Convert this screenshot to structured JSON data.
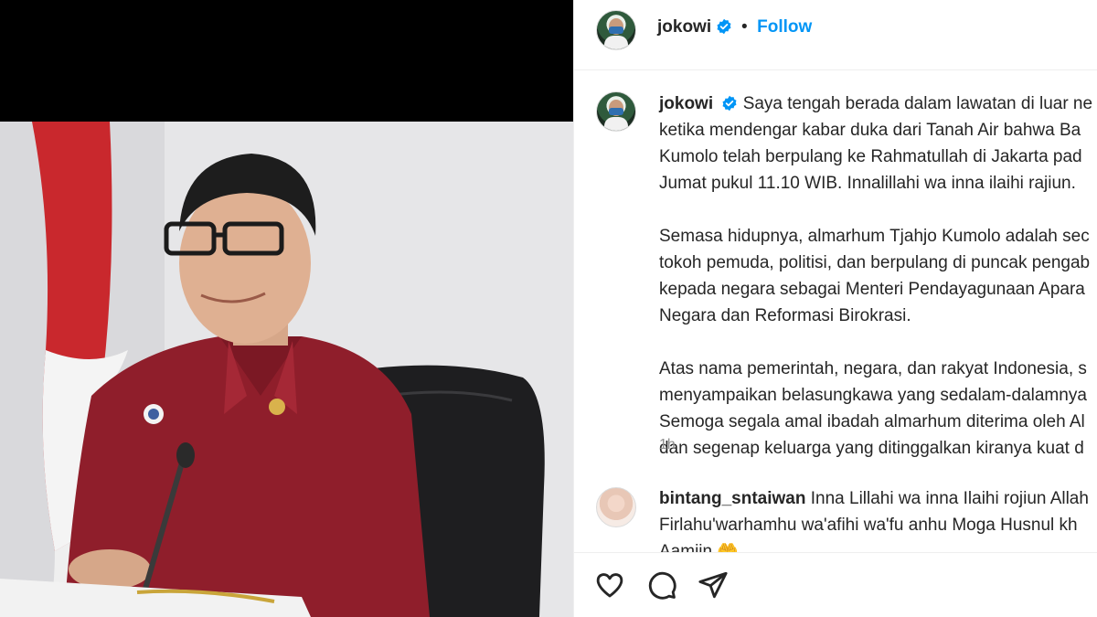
{
  "post": {
    "author": "jokowi",
    "follow_label": "Follow",
    "separator": "•",
    "time": "1h"
  },
  "caption": {
    "author": "jokowi",
    "lines_p1": [
      "Saya tengah berada dalam lawatan di luar ne",
      "ketika mendengar kabar duka dari Tanah Air bahwa Ba",
      "Kumolo telah berpulang ke Rahmatullah di Jakarta pad",
      "Jumat pukul 11.10 WIB. Innalillahi wa inna ilaihi rajiun."
    ],
    "lines_p2": [
      "Semasa hidupnya, almarhum Tjahjo Kumolo adalah sec",
      "tokoh pemuda, politisi, dan berpulang di puncak pengab",
      "kepada negara sebagai Menteri Pendayagunaan Apara",
      "Negara dan Reformasi Birokrasi."
    ],
    "lines_p3": [
      "Atas nama pemerintah, negara, dan rakyat Indonesia, s",
      "menyampaikan belasungkawa yang sedalam-dalamnya",
      "Semoga segala amal ibadah almarhum diterima oleh Al",
      "dan segenap keluarga yang ditinggalkan kiranya kuat d"
    ]
  },
  "comment": {
    "author": "bintang_sntaiwan",
    "line1": "Inna Lillahi wa inna Ilaihi rojiun Allah",
    "line2": "Firlahu'warhamhu wa'afihi wa'fu anhu Moga Husnul kh",
    "line3": "Aamiin",
    "emoji": "🤲"
  },
  "icons": [
    "heart-icon",
    "comment-icon",
    "share-icon",
    "verified-icon"
  ],
  "colors": {
    "accent": "#0095f6",
    "text": "#262626",
    "muted": "#8e8e8e"
  }
}
